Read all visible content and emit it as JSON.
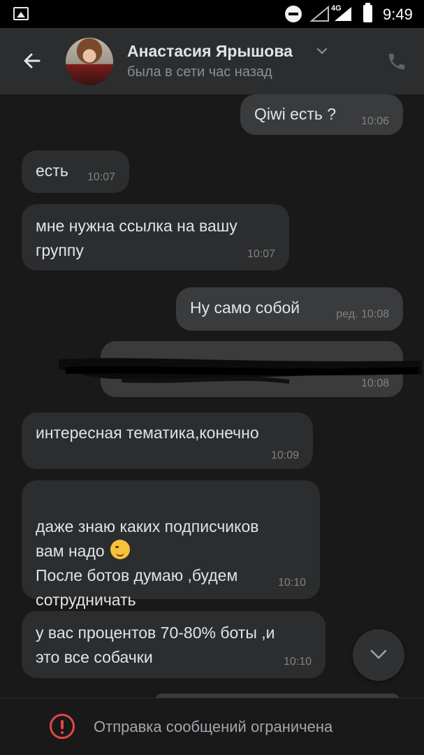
{
  "status_bar": {
    "network": "4G",
    "time": "9:49"
  },
  "header": {
    "contact_name": "Анастасия Ярышова",
    "last_seen": "была в сети час назад",
    "icons": [
      "back-arrow-icon",
      "chevron-down-icon",
      "phone-icon"
    ]
  },
  "messages": [
    {
      "direction": "out",
      "text": "Qiwi есть ?",
      "time": "10:06"
    },
    {
      "direction": "in",
      "text": "есть",
      "time": "10:07"
    },
    {
      "direction": "in",
      "text": "мне нужна ссылка на вашу\nгруппу",
      "time": "10:07"
    },
    {
      "direction": "out",
      "text": "Ну само собой",
      "time": "ред. 10:08"
    },
    {
      "direction": "out",
      "text": "",
      "time": "10:08",
      "redacted": true
    },
    {
      "direction": "in",
      "text": "интересная тематика,конечно",
      "time": "10:09"
    },
    {
      "direction": "in",
      "text": "даже знаю каких подписчиков\nвам надо",
      "text2": "После ботов думаю ,будем\nсотрудничать",
      "emoji": "winking-face",
      "time": "10:10"
    },
    {
      "direction": "in",
      "text": "у вас процентов 70-80% боты ,и\nэто все собачки",
      "time": "10:10"
    }
  ],
  "footer": {
    "notice": "Отправка сообщений ограничена"
  },
  "colors": {
    "background": "#19191a",
    "bubble": "#2c2d2e",
    "warning": "#e64646"
  }
}
